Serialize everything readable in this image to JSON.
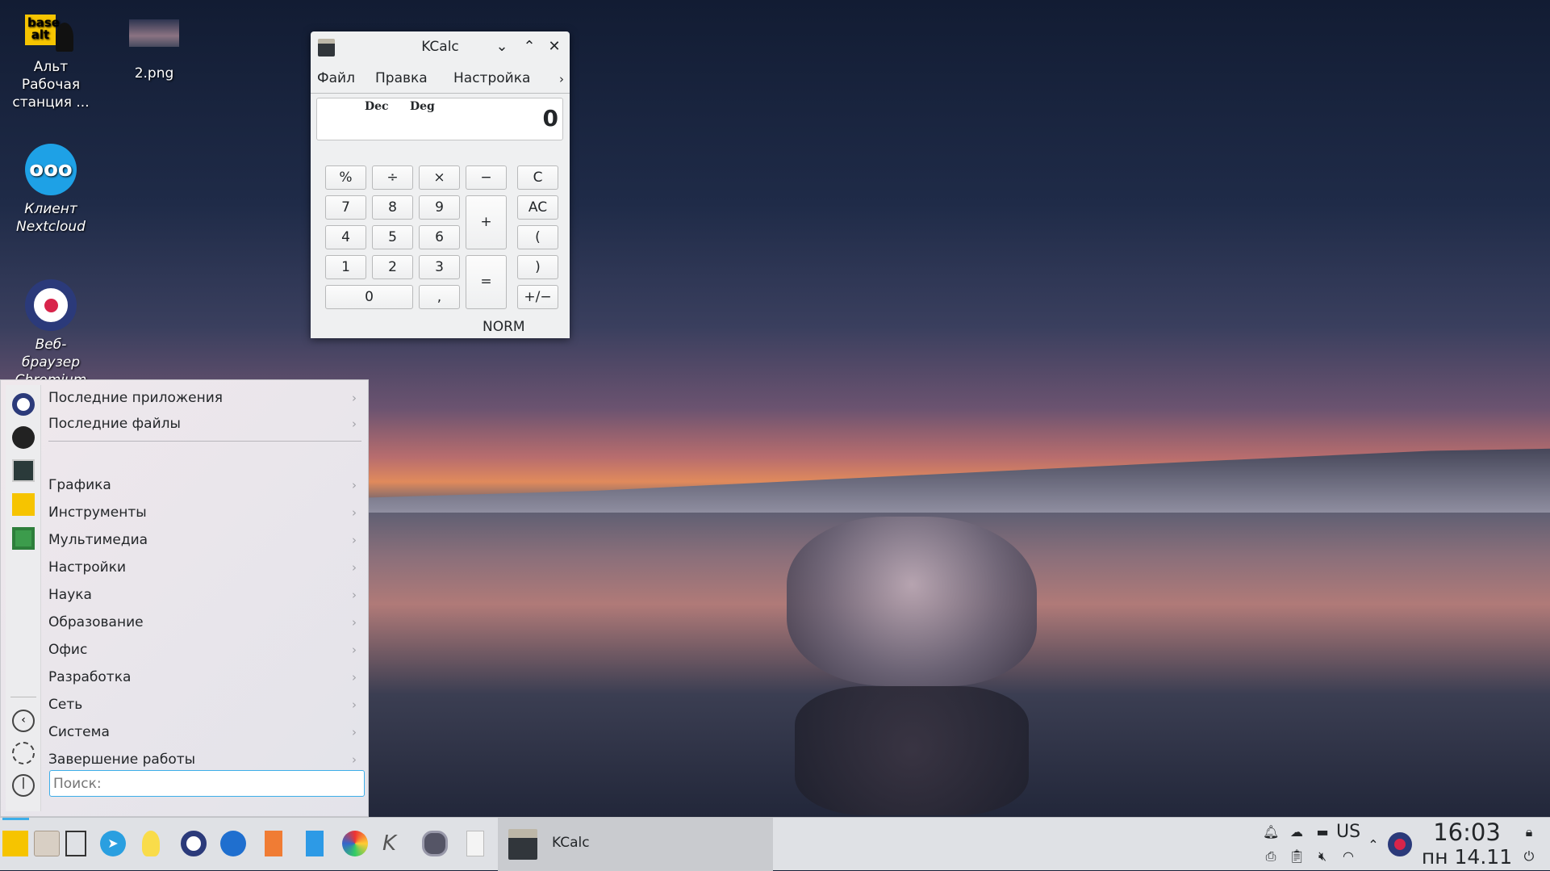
{
  "desktop": {
    "icons": [
      {
        "label": "Альт Рабочая станция ...",
        "icon": "basealt-logo-icon"
      },
      {
        "label": "2.png",
        "icon": "image-thumbnail-icon"
      },
      {
        "label": "Клиент Nextcloud",
        "icon": "nextcloud-icon"
      },
      {
        "label": "Веб-браузер Chromium",
        "icon": "chromium-icon"
      }
    ]
  },
  "kcalc": {
    "title": "KCalc",
    "menu": [
      "Файл",
      "Правка",
      "Настройка"
    ],
    "display": {
      "base": "Dec",
      "angle": "Deg",
      "value": "0"
    },
    "buttons": {
      "percent": "%",
      "divide": "÷",
      "multiply": "×",
      "minus": "−",
      "clear": "C",
      "seven": "7",
      "eight": "8",
      "nine": "9",
      "plus": "+",
      "all_clear": "AC",
      "four": "4",
      "five": "5",
      "six": "6",
      "open_paren": "(",
      "one": "1",
      "two": "2",
      "three": "3",
      "equals": "=",
      "close_paren": ")",
      "zero": "0",
      "decimal": ",",
      "sign": "+/−"
    },
    "status": "NORM"
  },
  "menu": {
    "items": [
      "Последние приложения",
      "Последние файлы",
      "Графика",
      "Инструменты",
      "Мультимедиа",
      "Настройки",
      "Наука",
      "Образование",
      "Офис",
      "Разработка",
      "Сеть",
      "Система",
      "Завершение работы"
    ],
    "search_placeholder": "Поиск:"
  },
  "taskbar": {
    "launchers": [
      "basealt-menu-icon",
      "folder-icon",
      "show-desktop-icon",
      "telegram-icon",
      "lightbulb-icon",
      "chromium-icon",
      "thunderbird-icon",
      "impress-icon",
      "writer-icon",
      "palette-icon",
      "kst-icon",
      "video-icon",
      "text-editor-icon"
    ],
    "task": {
      "label": "KCalc"
    },
    "tray": {
      "layout": "US",
      "time": "16:03",
      "date": "пн 14.11"
    },
    "accent": "#3daee9"
  }
}
